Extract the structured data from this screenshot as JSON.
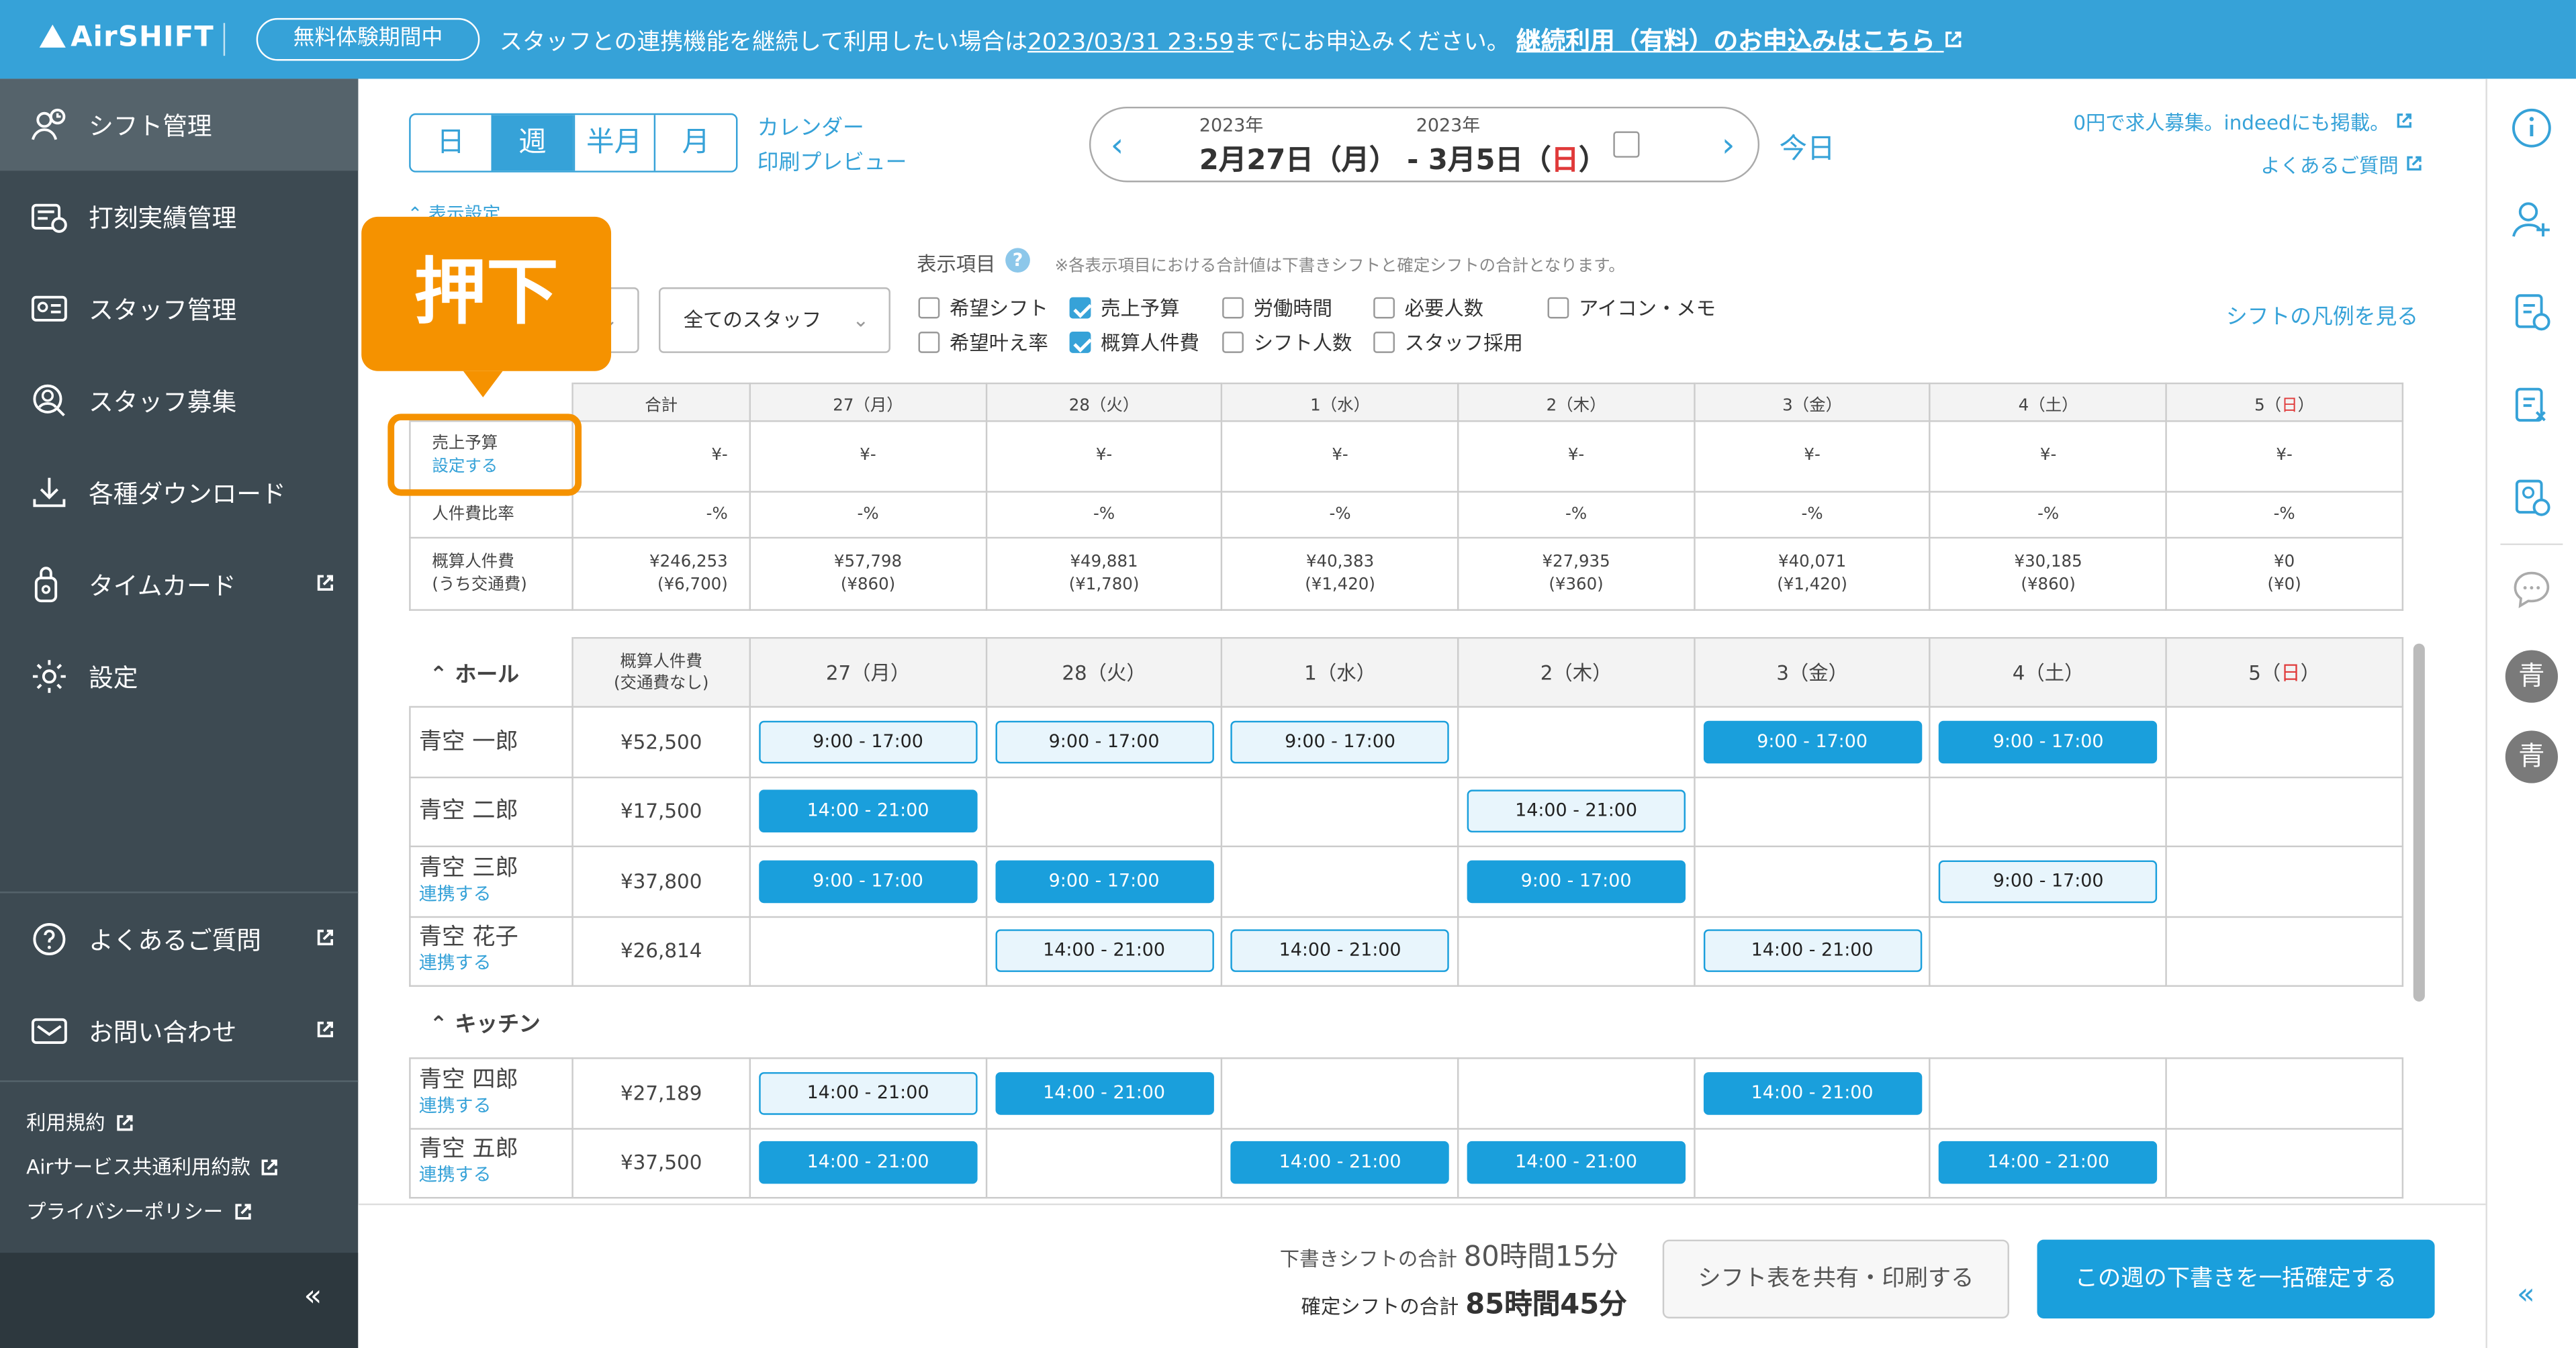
{
  "header": {
    "logo": "AirSHIFT",
    "trial_badge": "無料体験期間中",
    "notice_prefix": "スタッフとの連携機能を継続して利用したい場合は",
    "notice_date": "2023/03/31 23:59",
    "notice_suffix": "までにお申込みください。",
    "cta": "継続利用（有料）のお申込みはこちら"
  },
  "sidebar": {
    "items": [
      {
        "label": "シフト管理",
        "icon": "shift-icon"
      },
      {
        "label": "打刻実績管理",
        "icon": "timestamp-icon"
      },
      {
        "label": "スタッフ管理",
        "icon": "staff-icon"
      },
      {
        "label": "スタッフ募集",
        "icon": "recruit-icon"
      },
      {
        "label": "各種ダウンロード",
        "icon": "download-icon"
      },
      {
        "label": "タイムカード",
        "icon": "timecard-icon"
      },
      {
        "label": "設定",
        "icon": "gear-icon"
      }
    ],
    "faq": "よくあるご質問",
    "contact": "お問い合わせ",
    "links": [
      "利用規約",
      "Airサービス共通利用約款",
      "プライバシーポリシー"
    ],
    "collapse": "«"
  },
  "toolbar": {
    "views": [
      "日",
      "週",
      "半月",
      "月"
    ],
    "active_view": "週",
    "calendar_print_1": "カレンダー",
    "calendar_print_2": "印刷プレビュー",
    "year1": "2023年",
    "year2": "2023年",
    "date_start": "2月27日（月）",
    "date_sep": " - ",
    "date_end_pre": "3月5日（",
    "date_end_day": "日",
    "date_end_post": "）",
    "today": "今日",
    "indeed": "0円で求人募集。indeedにも掲載。",
    "faq": "よくあるご質問",
    "display_settings": "表示設定"
  },
  "filters": {
    "title": "表示項目",
    "note": "※各表示項目における合計値は下書きシフトと確定シフトの合計となります。",
    "staff_select": "全てのスタッフ",
    "checks": [
      {
        "label": "希望シフト",
        "checked": false
      },
      {
        "label": "売上予算",
        "checked": true
      },
      {
        "label": "労働時間",
        "checked": false
      },
      {
        "label": "必要人数",
        "checked": false
      },
      {
        "label": "アイコン・メモ",
        "checked": false
      },
      {
        "label": "希望叶え率",
        "checked": false
      },
      {
        "label": "概算人件費",
        "checked": true
      },
      {
        "label": "シフト人数",
        "checked": false
      },
      {
        "label": "スタッフ採用",
        "checked": false
      }
    ],
    "legend_link": "シフトの凡例を見る"
  },
  "summary_table": {
    "headers": [
      "合計",
      "27（月）",
      "28（火）",
      "1（水）",
      "2（木）",
      "3（金）",
      "4（土）",
      "5（"
    ],
    "sunday": "日",
    "close": "）",
    "sales_label": "売上予算",
    "sales_link": "設定する",
    "sales": [
      "¥-",
      "¥-",
      "¥-",
      "¥-",
      "¥-",
      "¥-",
      "¥-",
      "¥-"
    ],
    "ratio_label": "人件費比率",
    "ratio": [
      "-%",
      "-%",
      "-%",
      "-%",
      "-%",
      "-%",
      "-%",
      "-%"
    ],
    "cost_label1": "概算人件費",
    "cost_label2": "(うち交通費)",
    "costs": [
      "¥246,253",
      "¥57,798",
      "¥49,881",
      "¥40,383",
      "¥27,935",
      "¥40,071",
      "¥30,185",
      "¥0"
    ],
    "transport": [
      "(¥6,700)",
      "(¥860)",
      "(¥1,780)",
      "(¥1,420)",
      "(¥360)",
      "(¥1,420)",
      "(¥860)",
      "(¥0)"
    ]
  },
  "shift_table": {
    "group1": "ホール",
    "group2": "キッチン",
    "cost_header1": "概算人件費",
    "cost_header2": "(交通費なし)",
    "link": "連携する",
    "rows": [
      {
        "name": "青空 一郎",
        "linked": false,
        "cost": "¥52,500",
        "shifts": [
          [
            "9:00 - 17:00",
            "d"
          ],
          [
            "9:00 - 17:00",
            "d"
          ],
          [
            "9:00 - 17:00",
            "d"
          ],
          null,
          [
            "9:00 - 17:00",
            "c"
          ],
          [
            "9:00 - 17:00",
            "c"
          ],
          null
        ]
      },
      {
        "name": "青空 二郎",
        "linked": false,
        "cost": "¥17,500",
        "shifts": [
          [
            "14:00 - 21:00",
            "c"
          ],
          null,
          null,
          [
            "14:00 - 21:00",
            "d"
          ],
          null,
          null,
          null
        ]
      },
      {
        "name": "青空 三郎",
        "linked": true,
        "cost": "¥37,800",
        "shifts": [
          [
            "9:00 - 17:00",
            "c"
          ],
          [
            "9:00 - 17:00",
            "c"
          ],
          null,
          [
            "9:00 - 17:00",
            "c"
          ],
          null,
          [
            "9:00 - 17:00",
            "d"
          ],
          null
        ]
      },
      {
        "name": "青空 花子",
        "linked": true,
        "cost": "¥26,814",
        "shifts": [
          null,
          [
            "14:00 - 21:00",
            "d"
          ],
          [
            "14:00 - 21:00",
            "d"
          ],
          null,
          [
            "14:00 - 21:00",
            "d"
          ],
          null,
          null
        ]
      },
      {
        "name": "青空 四郎",
        "linked": true,
        "cost": "¥27,189",
        "shifts": [
          [
            "14:00 - 21:00",
            "d"
          ],
          [
            "14:00 - 21:00",
            "c"
          ],
          null,
          null,
          [
            "14:00 - 21:00",
            "c"
          ],
          null,
          null
        ]
      },
      {
        "name": "青空 五郎",
        "linked": true,
        "cost": "¥37,500",
        "shifts": [
          [
            "14:00 - 21:00",
            "c"
          ],
          null,
          [
            "14:00 - 21:00",
            "c"
          ],
          [
            "14:00 - 21:00",
            "c"
          ],
          null,
          [
            "14:00 - 21:00",
            "c"
          ],
          null
        ]
      }
    ]
  },
  "footer": {
    "draft_label": "下書きシフトの合計",
    "draft_value": "80時間15分",
    "confirmed_label": "確定シフトの合計",
    "confirmed_value": "85時間45分",
    "share_button": "シフト表を共有・印刷する",
    "confirm_button": "この週の下書きを一括確定する"
  },
  "rightbar": {
    "avatar1": "青",
    "avatar2": "青",
    "collapse": "«"
  },
  "callout": {
    "text": "押下"
  },
  "colors": {
    "brand": "#36a2d8",
    "sidebar": "#3d4a52",
    "accent_callout": "#f59200",
    "confirmed_shift": "#1a9fdc"
  }
}
